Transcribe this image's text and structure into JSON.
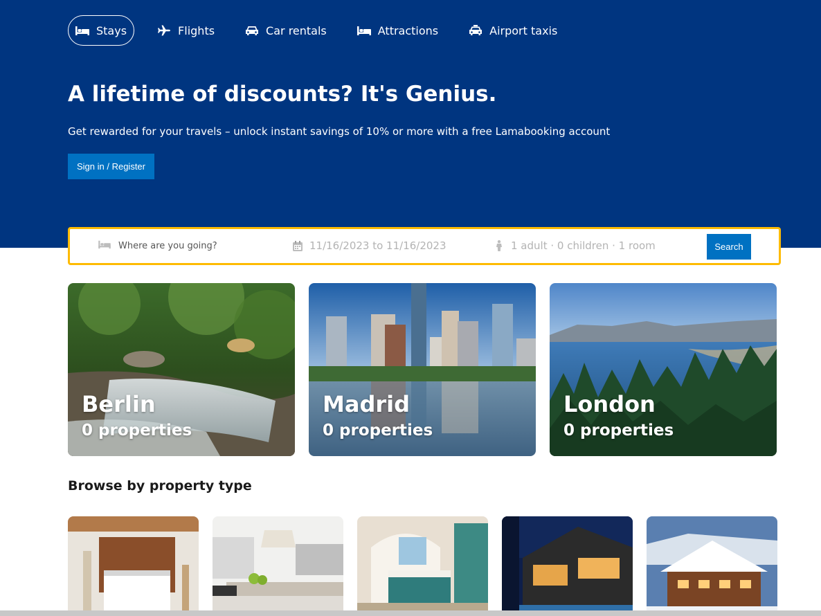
{
  "nav": {
    "items": [
      {
        "label": "Stays",
        "icon": "bed-icon",
        "active": true
      },
      {
        "label": "Flights",
        "icon": "plane-icon",
        "active": false
      },
      {
        "label": "Car rentals",
        "icon": "car-icon",
        "active": false
      },
      {
        "label": "Attractions",
        "icon": "bed-icon",
        "active": false
      },
      {
        "label": "Airport taxis",
        "icon": "taxi-icon",
        "active": false
      }
    ]
  },
  "hero": {
    "title": "A lifetime of discounts? It's Genius.",
    "subtitle": "Get rewarded for your travels – unlock instant savings of 10% or more with a free Lamabooking account",
    "signin_label": "Sign in / Register"
  },
  "search": {
    "destination_placeholder": "Where are you going?",
    "dates": "11/16/2023 to 11/16/2023",
    "guests": "1 adult · 0 children · 1 room",
    "button_label": "Search"
  },
  "featured": [
    {
      "city": "Berlin",
      "properties": "0 properties"
    },
    {
      "city": "Madrid",
      "properties": "0 properties"
    },
    {
      "city": "London",
      "properties": "0 properties"
    }
  ],
  "property_types": {
    "title": "Browse by property type"
  },
  "colors": {
    "brand_dark": "#003580",
    "brand_button": "#0071c2",
    "search_border": "#febb02"
  }
}
